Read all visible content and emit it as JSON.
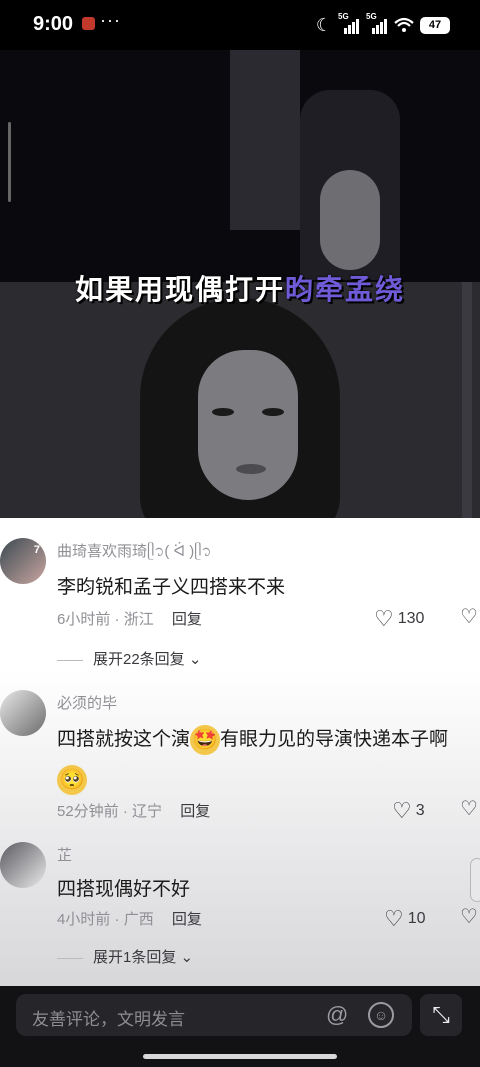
{
  "status_bar": {
    "time": "9:00",
    "dots": "···",
    "signal1_tag": "5G",
    "signal2_tag": "5G",
    "battery": "47"
  },
  "video": {
    "overlay_part1": "如果用现偶打开",
    "overlay_highlight": "昀牵孟绕",
    "highlight_color": "#6f5bd8"
  },
  "comments": [
    {
      "username": "曲琦喜欢雨琦ᥫ᭡( ᐛ )ᥫ᭡",
      "text": "李昀锐和孟子义四搭来不来",
      "time": "6小时前",
      "location": "浙江",
      "reply_label": "回复",
      "likes": "130",
      "expand_label": "展开22条回复",
      "avatar_badge": "7"
    },
    {
      "username": "必须的毕",
      "text_before": "四搭就按这个演",
      "text_after": "有眼力见的导演快递本子啊",
      "emoji1": "🤩",
      "emoji2": "🥺",
      "time": "52分钟前",
      "location": "辽宁",
      "reply_label": "回复",
      "likes": "3"
    },
    {
      "username": "芷",
      "text": "四搭现偶好不好",
      "time": "4小时前",
      "location": "广西",
      "reply_label": "回复",
      "likes": "10",
      "expand_label": "展开1条回复"
    }
  ],
  "bottom_bar": {
    "input_placeholder": "友善评论，文明发言",
    "at_symbol": "@",
    "smile_symbol": "☺",
    "expand_symbol": "⤡"
  },
  "icons": {
    "like": "heart-outline-icon",
    "dislike": "broken-heart-icon",
    "chevron": "chevron-down-icon"
  }
}
